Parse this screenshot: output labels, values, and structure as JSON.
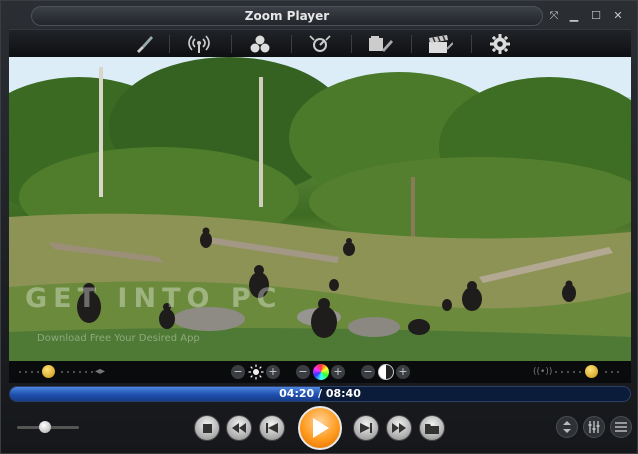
{
  "window": {
    "title": "Zoom Player",
    "controls": [
      "restore-icon",
      "minimize-icon",
      "maximize-icon",
      "close-icon"
    ]
  },
  "toolbar": {
    "items": [
      {
        "name": "brush-icon"
      },
      {
        "name": "broadcast-icon"
      },
      {
        "name": "color-circles-icon"
      },
      {
        "name": "playback-settings-icon"
      },
      {
        "name": "media-library-icon"
      },
      {
        "name": "clapperboard-icon"
      },
      {
        "name": "gear-icon"
      }
    ]
  },
  "video": {
    "watermark": "GET INTO PC",
    "watermark_sub": "Download Free Your Desired App"
  },
  "adjustments": {
    "brightness": {
      "minus": "−",
      "plus": "+"
    },
    "color": {
      "minus": "−",
      "plus": "+"
    },
    "contrast": {
      "minus": "−",
      "plus": "+"
    }
  },
  "playback": {
    "current_time": "04:20",
    "total_time": "08:40",
    "time_display": "04:20 / 08:40",
    "progress_fraction": 0.5,
    "volume_fraction": 0.45
  },
  "colors": {
    "accent_play": "#ff9a1c",
    "progress_fill": "#1e4fae",
    "gold_dot": "#e0b020"
  }
}
